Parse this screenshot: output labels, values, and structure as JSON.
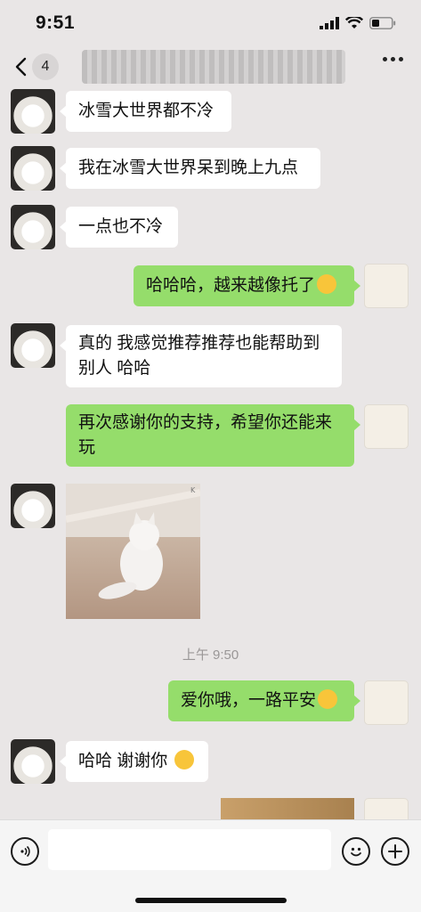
{
  "status_bar": {
    "time": "9:51"
  },
  "nav": {
    "back_badge": "4"
  },
  "messages": [
    {
      "side": "in",
      "text": "冰雪大世界都不冷"
    },
    {
      "side": "in",
      "text": "我在冰雪大世界呆到晚上九点"
    },
    {
      "side": "in",
      "text": "一点也不冷"
    },
    {
      "side": "out",
      "text": "哈哈哈，越来越像托了"
    },
    {
      "side": "in",
      "text": "真的 我感觉推荐推荐也能帮助到别人 哈哈"
    },
    {
      "side": "out",
      "text": "再次感谢你的支持，希望你还能来玩"
    },
    {
      "side": "out",
      "text": "爱你哦，一路平安"
    },
    {
      "side": "in",
      "text": "哈哈 谢谢你"
    }
  ],
  "timestamp": "上午 9:50",
  "colors": {
    "outgoing_bubble": "#95dd6b",
    "incoming_bubble": "#ffffff",
    "background": "#e9e6e6"
  },
  "icons": {
    "back": "chevron-left-icon",
    "more": "more-dots-icon",
    "voice": "voice-icon",
    "emoji": "emoji-icon",
    "plus": "plus-icon"
  }
}
